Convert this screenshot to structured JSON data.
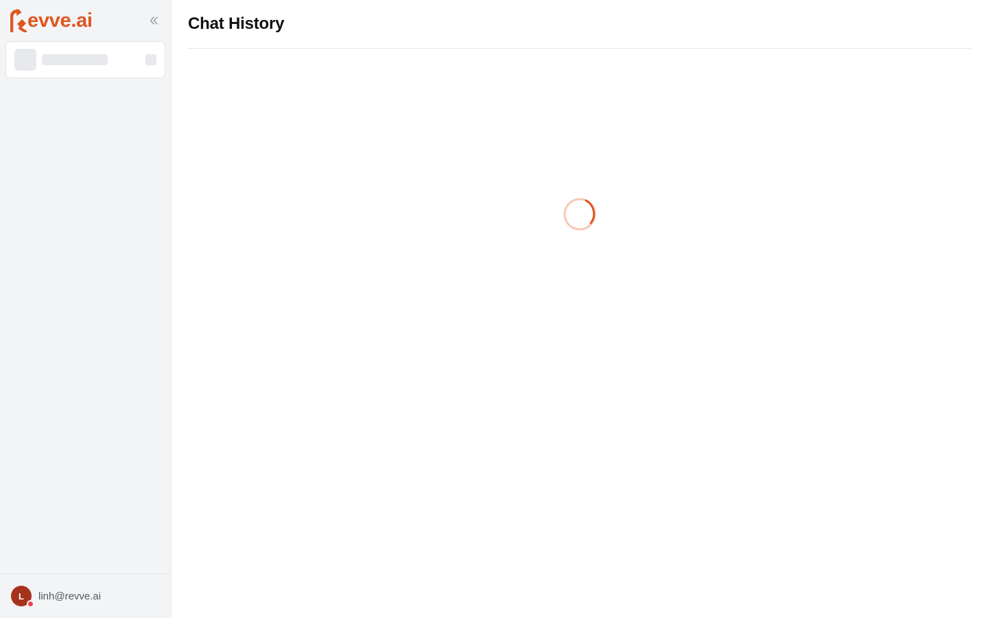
{
  "brand": {
    "name": "evve.ai",
    "color": "#e0561f"
  },
  "sidebar": {
    "collapse_icon": "chevrons-left-icon",
    "workspace_loading": true,
    "user": {
      "initial": "L",
      "email": "linh@revve.ai",
      "avatar_color": "#a6341c",
      "status_color": "#ef4444"
    }
  },
  "main": {
    "title": "Chat History",
    "loading_icon": "spinner-icon",
    "accent": "#e0561f"
  }
}
